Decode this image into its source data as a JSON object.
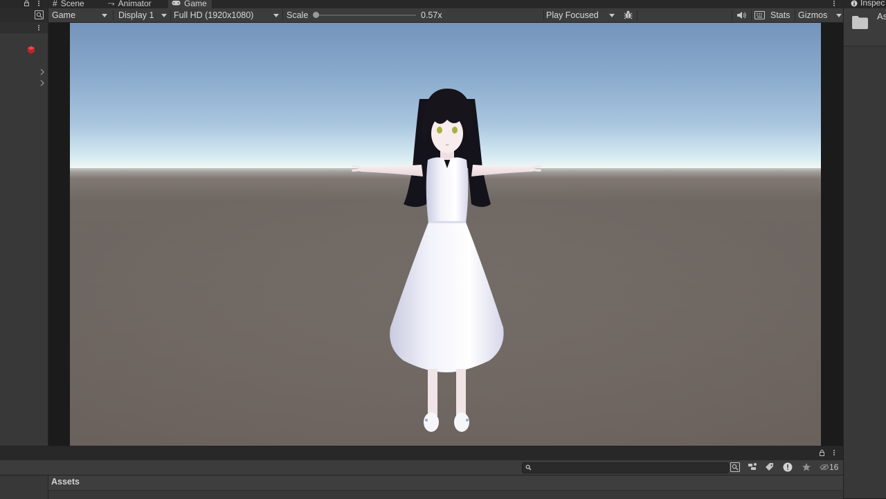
{
  "tabs": [
    {
      "label": "Scene",
      "icon": "hash-icon"
    },
    {
      "label": "Animator",
      "icon": "animator-icon"
    },
    {
      "label": "Game",
      "icon": "gamepad-icon",
      "active": true
    }
  ],
  "toolbar": {
    "game_dropdown": "Game",
    "display_dropdown": "Display 1",
    "resolution_dropdown": "Full HD (1920x1080)",
    "scale_label": "Scale",
    "scale_value": "0.57x",
    "scale_fraction": 0.0,
    "play_mode_dropdown": "Play Focused",
    "stats_label": "Stats",
    "gizmos_label": "Gizmos"
  },
  "inspector": {
    "tab_label": "Inspec",
    "asset_label": "As"
  },
  "project": {
    "search_placeholder": "",
    "visibility_count": "16",
    "breadcrumb": "Assets"
  },
  "colors": {
    "panel": "#383838",
    "toolbar": "#3c3c3c",
    "tabstrip": "#282828",
    "sky_top": "#7494bb",
    "horizon": "#f3f8f4",
    "ground": "#6f6661",
    "hierarchy_object_icon": "#c0242b"
  },
  "icons": [
    "lock-icon",
    "maximize-icon",
    "kebab-menu-icon",
    "scene-object-icon",
    "chevron-right-icon",
    "debug-bug-icon",
    "mute-audio-icon",
    "keyboard-icon",
    "folder-icon",
    "search-icon",
    "asset-labels-icon",
    "warning-icon",
    "star-icon",
    "eye-icon"
  ]
}
